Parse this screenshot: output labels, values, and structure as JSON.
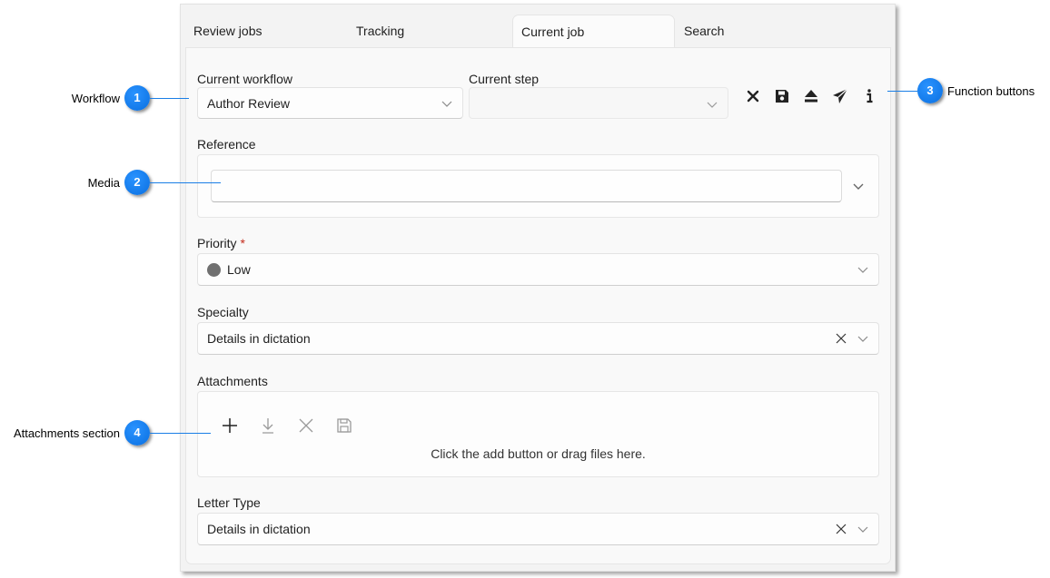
{
  "tabs": [
    {
      "label": "Review jobs",
      "active": false
    },
    {
      "label": "Tracking",
      "active": false
    },
    {
      "label": "Current job",
      "active": true
    },
    {
      "label": "Search",
      "active": false
    }
  ],
  "form": {
    "current_workflow": {
      "label": "Current workflow",
      "value": "Author Review"
    },
    "current_step": {
      "label": "Current step",
      "value": ""
    },
    "function_buttons": [
      {
        "name": "close",
        "icon": "close-icon"
      },
      {
        "name": "save",
        "icon": "save-icon"
      },
      {
        "name": "eject",
        "icon": "eject-icon"
      },
      {
        "name": "send",
        "icon": "send-icon"
      },
      {
        "name": "info",
        "icon": "info-icon"
      }
    ],
    "reference": {
      "label": "Reference",
      "value": ""
    },
    "priority": {
      "label": "Priority",
      "required_marker": "*",
      "value": "Low",
      "color": "#707070"
    },
    "specialty": {
      "label": "Specialty",
      "value": "Details in dictation"
    },
    "attachments": {
      "label": "Attachments",
      "buttons": [
        "add-icon",
        "download-icon",
        "delete-icon",
        "save-icon"
      ],
      "hint": "Click the add button or drag files here."
    },
    "letter_type": {
      "label": "Letter Type",
      "value": "Details in dictation"
    }
  },
  "callouts": [
    {
      "number": "1",
      "text": "Workflow"
    },
    {
      "number": "2",
      "text": "Media"
    },
    {
      "number": "3",
      "text": "Function buttons"
    },
    {
      "number": "4",
      "text": "Attachments section"
    }
  ],
  "colors": {
    "accent": "#0a6fe0",
    "required": "#c42b1c"
  }
}
